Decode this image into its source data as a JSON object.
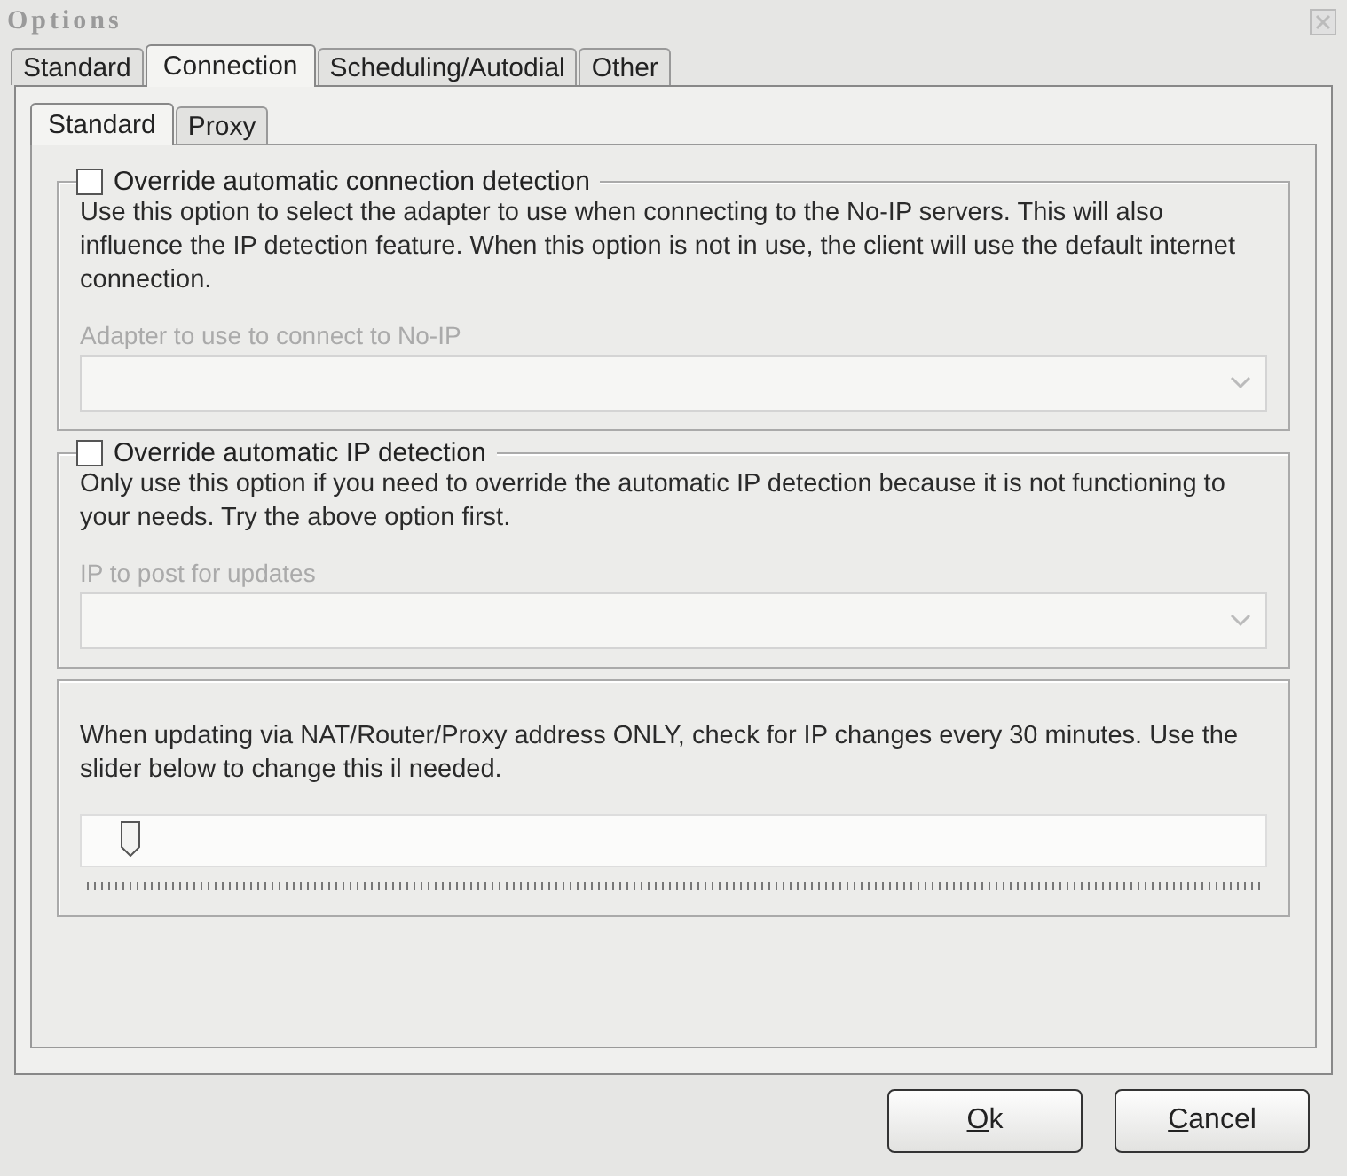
{
  "window": {
    "title": "Options"
  },
  "tabs": [
    {
      "label": "Standard",
      "selected": false
    },
    {
      "label": "Connection",
      "selected": true
    },
    {
      "label": "Scheduling/Autodial",
      "selected": false
    },
    {
      "label": "Other",
      "selected": false
    }
  ],
  "subtabs": [
    {
      "label": "Standard",
      "selected": true
    },
    {
      "label": "Proxy",
      "selected": false
    }
  ],
  "groups": [
    {
      "kind": "checkbox",
      "label": "Override automatic connection detection",
      "checked": false,
      "description": "Use this option to select the adapter to use when connecting to the No-IP servers.  This will also influence the IP detection feature.  When this option is not in use, the client will use the default internet connection.",
      "field_label": "Adapter to use to connect to No-IP",
      "disabled": true
    },
    {
      "kind": "checkbox",
      "label": "Override automatic IP detection",
      "checked": false,
      "description": "Only use this option if you need to override the automatic IP detection because it is not functioning to your needs.  Try the above option first.",
      "field_label": "IP to post for updates",
      "disabled": true
    },
    {
      "kind": "slider",
      "description": "When updating via NAT/Router/Proxy address ONLY, check for IP changes every 30 minutes.  Use the slider below to change this il needed.",
      "level": 0.04
    }
  ],
  "buttons": [
    {
      "label": "Ok"
    },
    {
      "label": "Cancel"
    }
  ]
}
